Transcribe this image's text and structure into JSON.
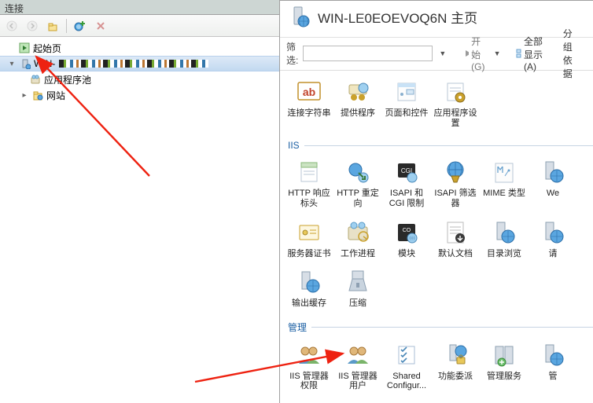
{
  "left": {
    "header": "连接",
    "tree": {
      "start": "起始页",
      "server_prefix": "WIN-",
      "app_pools": "应用程序池",
      "sites": "网站"
    }
  },
  "header": {
    "title": "WIN-LE0EOEVOQ6N 主页"
  },
  "filter": {
    "label": "筛选:",
    "placeholder": "",
    "begin": "开始(G)",
    "show_all": "全部显示(A)",
    "group_by": "分组依据"
  },
  "groups": {
    "aspnet_items": [
      "连接字符串",
      "提供程序",
      "页面和控件",
      "应用程序设置"
    ],
    "iis_label": "IIS",
    "iis_items": [
      "HTTP 响应标头",
      "HTTP 重定向",
      "ISAPI 和 CGI 限制",
      "ISAPI 筛选器",
      "MIME 类型",
      "We",
      "服务器证书",
      "工作进程",
      "模块",
      "默认文档",
      "目录浏览",
      "请",
      "输出缓存",
      "压缩"
    ],
    "mgmt_label": "管理",
    "mgmt_items": [
      "IIS 管理器权限",
      "IIS 管理器用户",
      "Shared Configur...",
      "功能委派",
      "管理服务",
      "管"
    ]
  }
}
